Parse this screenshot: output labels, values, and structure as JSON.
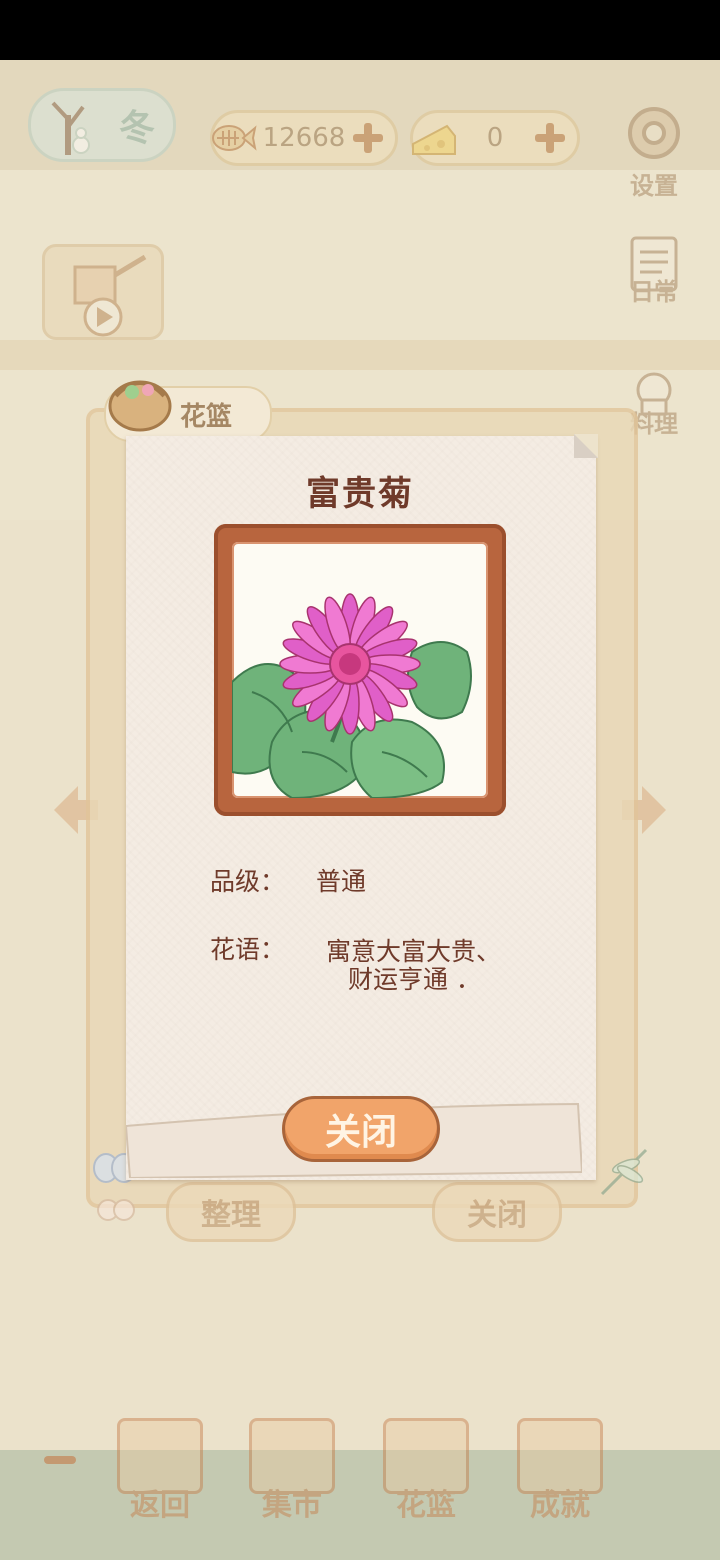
{
  "hud": {
    "season": "冬",
    "fish_currency": "12668",
    "cheese_currency": "0",
    "settings_label": "设置",
    "daily_label": "日常",
    "cooking_label": "料理"
  },
  "panel": {
    "tab_label": "花篮",
    "left_button": "整理",
    "right_button": "关闭"
  },
  "card": {
    "flower_name": "富贵菊",
    "grade_label": "品级：",
    "grade_value": "普通",
    "meaning_label": "花语：",
    "meaning_line1": "寓意大富大贵、",
    "meaning_line2": "财运亨通 ．",
    "close_button": "关闭"
  },
  "bottom_nav": {
    "back": "返回",
    "market": "集市",
    "basket": "花篮",
    "achievement": "成就"
  },
  "colors": {
    "title_brown": "#6f3a2a",
    "close_orange": "#f1a46a",
    "frame_brown": "#b8653e",
    "petal_pink": "#e05fc8"
  }
}
